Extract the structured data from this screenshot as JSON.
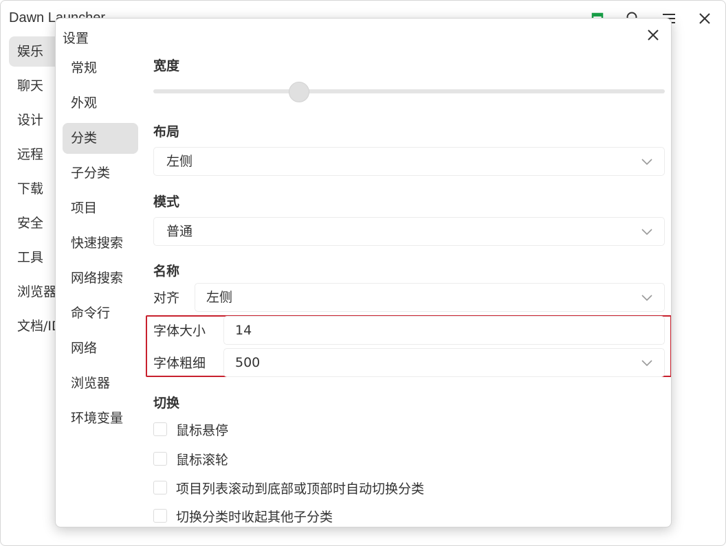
{
  "app": {
    "title": "Dawn Launcher",
    "categories": [
      "娱乐",
      "聊天",
      "设计",
      "远程",
      "下载",
      "安全",
      "工具",
      "浏览器",
      "文档/ID"
    ],
    "active_category_index": 0,
    "accent_color": "#1aa34a"
  },
  "dialog": {
    "title": "设置",
    "nav": [
      "常规",
      "外观",
      "分类",
      "子分类",
      "项目",
      "快速搜索",
      "网络搜索",
      "命令行",
      "网络",
      "浏览器",
      "环境变量"
    ],
    "active_nav_index": 2,
    "sections": {
      "width": {
        "label": "宽度",
        "slider_fraction": 0.285
      },
      "layout": {
        "label": "布局",
        "value": "左侧"
      },
      "mode": {
        "label": "模式",
        "value": "普通"
      },
      "name": {
        "label": "名称",
        "align_label": "对齐",
        "align_value": "左侧",
        "font_size_label": "字体大小",
        "font_size_value": "14",
        "font_weight_label": "字体粗细",
        "font_weight_value": "500"
      },
      "switch": {
        "label": "切换",
        "options": [
          {
            "label": "鼠标悬停",
            "checked": false
          },
          {
            "label": "鼠标滚轮",
            "checked": false
          },
          {
            "label": "项目列表滚动到底部或顶部时自动切换分类",
            "checked": false
          },
          {
            "label": "切换分类时收起其他子分类",
            "checked": false
          }
        ]
      }
    },
    "highlight_color": "#c8202d"
  }
}
